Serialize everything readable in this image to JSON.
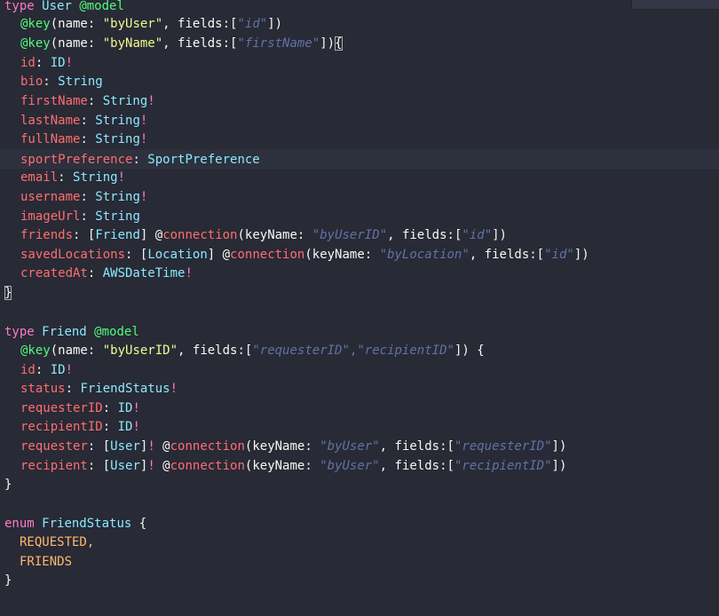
{
  "model_user": {
    "kw_type": "type",
    "name": "User",
    "directive": "@model",
    "key1": {
      "kw": "@key",
      "open": "(name: ",
      "name": "\"byUser\"",
      "mid": ", fields:[",
      "q1": "\"",
      "field": "id",
      "q2": "\"",
      "close": "])"
    },
    "key2": {
      "kw": "@key",
      "open": "(name: ",
      "name": "\"byName\"",
      "mid": ", fields:[",
      "q1": "\"",
      "field": "firstName",
      "q2": "\"",
      "close": "])",
      "brace": "{"
    },
    "fields": [
      {
        "name": "id",
        "colon": ": ",
        "type": "ID",
        "bang": "!"
      },
      {
        "name": "bio",
        "colon": ": ",
        "type": "String",
        "bang": ""
      },
      {
        "name": "firstName",
        "colon": ": ",
        "type": "String",
        "bang": "!"
      },
      {
        "name": "lastName",
        "colon": ": ",
        "type": "String",
        "bang": "!"
      },
      {
        "name": "fullName",
        "colon": ": ",
        "type": "String",
        "bang": "!"
      },
      {
        "name": "sportPreference",
        "colon": ": ",
        "type": "SportPreference",
        "bang": ""
      },
      {
        "name": "email",
        "colon": ": ",
        "type": "String",
        "bang": "!"
      },
      {
        "name": "username",
        "colon": ": ",
        "type": "String",
        "bang": "!"
      },
      {
        "name": "imageUrl",
        "colon": ": ",
        "type": "String",
        "bang": ""
      }
    ],
    "friends": {
      "name": "friends",
      "colon": ": ",
      "lb": "[",
      "type": "Friend",
      "rb": "]",
      "at": " @",
      "conn": "connection",
      "open": "(keyName: ",
      "kq1": "\"",
      "key": "byUserID",
      "kq2": "\"",
      "mid": ", fields:[",
      "fq1": "\"",
      "field": "id",
      "fq2": "\"",
      "close": "])"
    },
    "savedLocations": {
      "name": "savedLocations",
      "colon": ": ",
      "lb": "[",
      "type": "Location",
      "rb": "]",
      "at": " @",
      "conn": "connection",
      "open": "(keyName: ",
      "kq1": "\"",
      "key": "byLocation",
      "kq2": "\"",
      "mid": ", fields:[",
      "fq1": "\"",
      "field": "id",
      "fq2": "\"",
      "close": "])"
    },
    "createdAt": {
      "name": "createdAt",
      "colon": ": ",
      "type": "AWSDateTime",
      "bang": "!"
    },
    "close": "}"
  },
  "model_friend": {
    "kw_type": "type",
    "name": "Friend",
    "directive": "@model",
    "key1": {
      "kw": "@key",
      "open": "(name: ",
      "name": "\"byUserID\"",
      "mid": ", fields:[",
      "q1": "\"",
      "f1": "requesterID",
      "q2": "\",\"",
      "f2": "recipientID",
      "q3": "\"",
      "close": "]) {"
    },
    "fields": [
      {
        "name": "id",
        "colon": ": ",
        "type": "ID",
        "bang": "!"
      },
      {
        "name": "status",
        "colon": ": ",
        "type": "FriendStatus",
        "bang": "!"
      },
      {
        "name": "requesterID",
        "colon": ": ",
        "type": "ID",
        "bang": "!"
      },
      {
        "name": "recipientID",
        "colon": ": ",
        "type": "ID",
        "bang": "!"
      }
    ],
    "requester": {
      "name": "requester",
      "colon": ": ",
      "lb": "[",
      "type": "User",
      "rb": "]",
      "bang": "!",
      "at": " @",
      "conn": "connection",
      "open": "(keyName: ",
      "kq1": "\"",
      "key": "byUser",
      "kq2": "\"",
      "mid": ", fields:[",
      "fq1": "\"",
      "field": "requesterID",
      "fq2": "\"",
      "close": "])"
    },
    "recipient": {
      "name": "recipient",
      "colon": ": ",
      "lb": "[",
      "type": "User",
      "rb": "]",
      "bang": "!",
      "at": " @",
      "conn": "connection",
      "open": "(keyName: ",
      "kq1": "\"",
      "key": "byUser",
      "kq2": "\"",
      "mid": ", fields:[",
      "fq1": "\"",
      "field": "recipientID",
      "fq2": "\"",
      "close": "])"
    },
    "close": "}"
  },
  "enum_status": {
    "kw": "enum",
    "name": "FriendStatus",
    "open": " {",
    "values": [
      "REQUESTED,",
      "FRIENDS"
    ],
    "close": "}"
  },
  "colors": {
    "background": "#282a36",
    "keyword": "#ff79c6",
    "type": "#8be9fd",
    "directive": "#50fa7b",
    "string": "#f1fa8c",
    "field": "#ff6e6e",
    "enum_value": "#ffb86c",
    "comment_italic": "#6272a4"
  }
}
